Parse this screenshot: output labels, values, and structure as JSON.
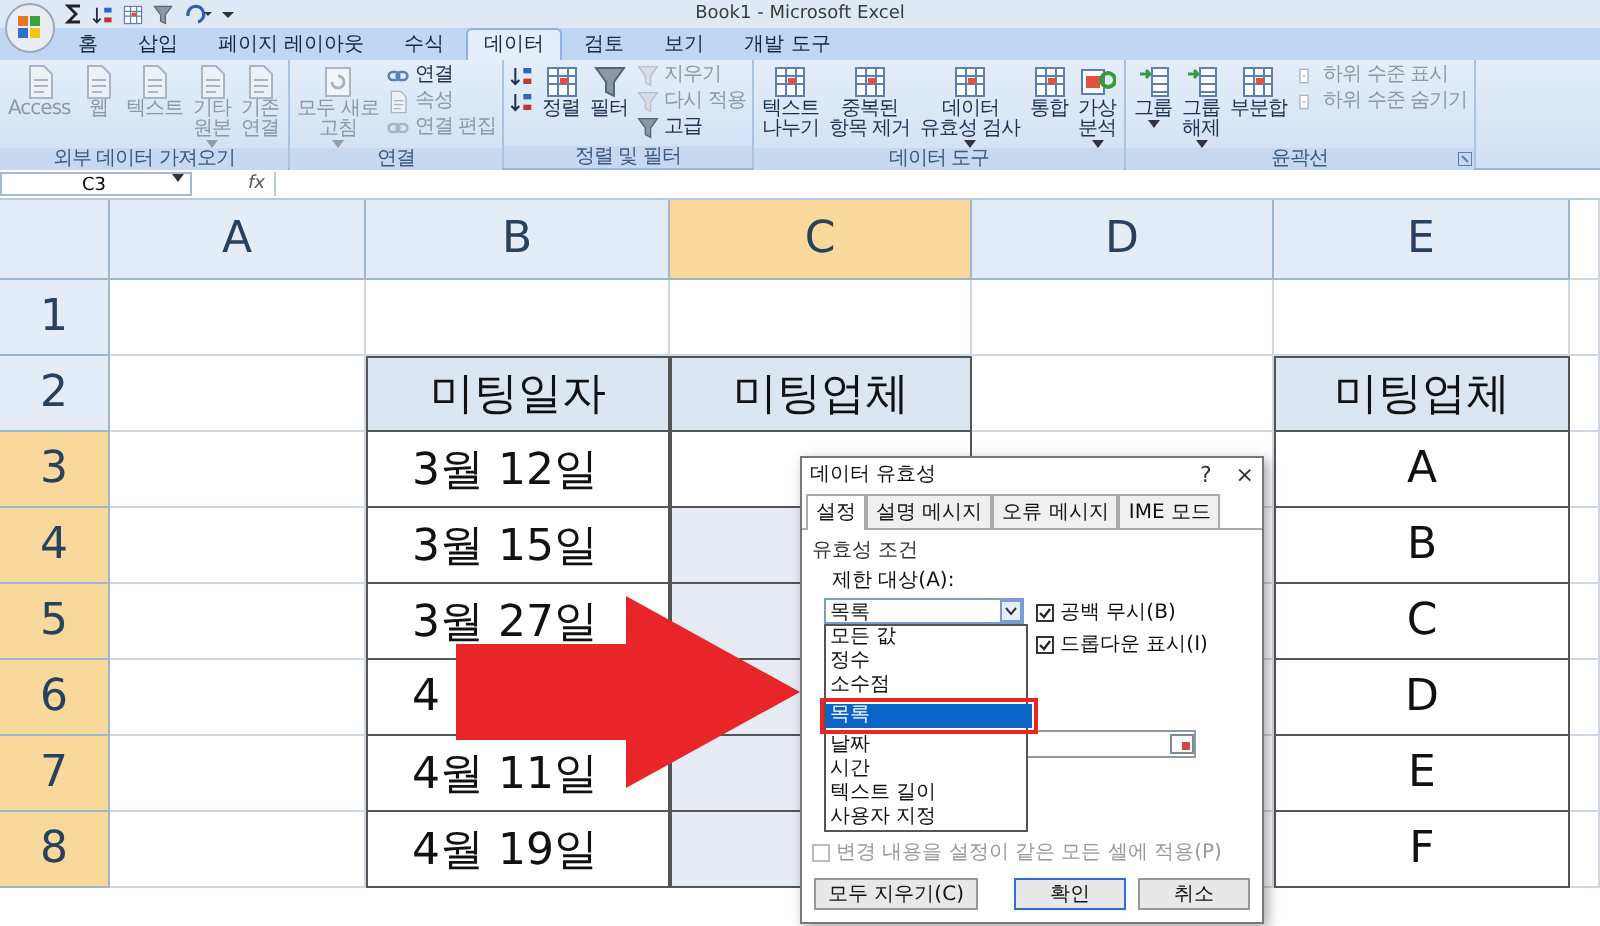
{
  "window": {
    "title": "Book1 - Microsoft Excel"
  },
  "tabs": [
    {
      "label": "홈",
      "selected": false
    },
    {
      "label": "삽입",
      "selected": false
    },
    {
      "label": "페이지 레이아웃",
      "selected": false
    },
    {
      "label": "수식",
      "selected": false
    },
    {
      "label": "데이터",
      "selected": true
    },
    {
      "label": "검토",
      "selected": false
    },
    {
      "label": "보기",
      "selected": false
    },
    {
      "label": "개발 도구",
      "selected": false
    }
  ],
  "ribbon": {
    "groups": [
      {
        "label": "외부 데이터 가져오기",
        "items": [
          {
            "kind": "large",
            "label": "Access",
            "disabled": true
          },
          {
            "kind": "large",
            "label": "웹",
            "disabled": true
          },
          {
            "kind": "large",
            "label": "텍스트",
            "disabled": true
          },
          {
            "kind": "large",
            "label": "기타\n원본",
            "menu": true,
            "disabled": true
          },
          {
            "kind": "large",
            "label": "기존\n연결",
            "disabled": true
          }
        ]
      },
      {
        "label": "연결",
        "items": [
          {
            "kind": "large",
            "label": "모두 새로\n고침",
            "menu": true,
            "disabled": true
          },
          {
            "kind": "stack",
            "items": [
              {
                "label": "연결",
                "disabled": false
              },
              {
                "label": "속성",
                "disabled": true
              },
              {
                "label": "연결 편집",
                "disabled": true
              }
            ]
          }
        ]
      },
      {
        "label": "정렬 및 필터",
        "items": [
          {
            "kind": "stack",
            "items": [
              {
                "disabled": false
              },
              {
                "disabled": false
              }
            ]
          },
          {
            "kind": "large",
            "label": "정렬",
            "disabled": false
          },
          {
            "kind": "large",
            "label": "필터",
            "disabled": false
          },
          {
            "kind": "stack",
            "items": [
              {
                "label": "지우기",
                "disabled": true
              },
              {
                "label": "다시 적용",
                "disabled": true
              },
              {
                "label": "고급",
                "disabled": false
              }
            ]
          }
        ]
      },
      {
        "label": "데이터 도구",
        "items": [
          {
            "kind": "large",
            "label": "텍스트\n나누기",
            "disabled": false
          },
          {
            "kind": "large",
            "label": "중복된\n항목 제거",
            "disabled": false
          },
          {
            "kind": "large",
            "label": "데이터\n유효성 검사",
            "menu": true,
            "disabled": false
          },
          {
            "kind": "large",
            "label": "통합",
            "disabled": false
          },
          {
            "kind": "large",
            "label": "가상\n분석",
            "menu": true,
            "disabled": false
          }
        ]
      },
      {
        "label": "윤곽선",
        "launcher": true,
        "items": [
          {
            "kind": "large",
            "label": "그룹",
            "menu": true,
            "disabled": false
          },
          {
            "kind": "large",
            "label": "그룹\n해제",
            "menu": true,
            "disabled": false
          },
          {
            "kind": "large",
            "label": "부분합",
            "disabled": false
          },
          {
            "kind": "stack",
            "items": [
              {
                "label": "하위 수준 표시",
                "disabled": true
              },
              {
                "label": "하위 수준 숨기기",
                "disabled": true
              }
            ]
          }
        ]
      }
    ]
  },
  "formula_bar": {
    "name_box": "C3",
    "function_label": "fx"
  },
  "sheet": {
    "columns": [
      {
        "label": "A",
        "selected": false
      },
      {
        "label": "B",
        "selected": false
      },
      {
        "label": "C",
        "selected": true
      },
      {
        "label": "D",
        "selected": false
      },
      {
        "label": "E",
        "selected": false
      }
    ],
    "rows": [
      {
        "label": "1",
        "selected": false,
        "cells": [
          "",
          "",
          "",
          "",
          ""
        ]
      },
      {
        "label": "2",
        "selected": false,
        "cells": [
          "",
          {
            "kind": "header",
            "text": "미팅일자"
          },
          {
            "kind": "header",
            "text": "미팅업체"
          },
          "",
          {
            "kind": "header",
            "text": "미팅업체"
          }
        ]
      },
      {
        "label": "3",
        "selected": true,
        "cells": [
          "",
          {
            "kind": "date",
            "text": "3월 12일"
          },
          {
            "kind": "input",
            "selected": false
          },
          "",
          {
            "kind": "data",
            "text": "A"
          }
        ]
      },
      {
        "label": "4",
        "selected": true,
        "cells": [
          "",
          {
            "kind": "date",
            "text": "3월 15일"
          },
          {
            "kind": "input",
            "selected": true
          },
          "",
          {
            "kind": "data",
            "text": "B"
          }
        ]
      },
      {
        "label": "5",
        "selected": true,
        "cells": [
          "",
          {
            "kind": "date",
            "text": "3월 27일"
          },
          {
            "kind": "input",
            "selected": true
          },
          "",
          {
            "kind": "data",
            "text": "C"
          }
        ]
      },
      {
        "label": "6",
        "selected": true,
        "cells": [
          "",
          {
            "kind": "date",
            "text": "4"
          },
          {
            "kind": "input",
            "selected": true
          },
          "",
          {
            "kind": "data",
            "text": "D"
          }
        ]
      },
      {
        "label": "7",
        "selected": true,
        "cells": [
          "",
          {
            "kind": "date",
            "text": "4월 11일"
          },
          {
            "kind": "input",
            "selected": true
          },
          "",
          {
            "kind": "data",
            "text": "E"
          }
        ]
      },
      {
        "label": "8",
        "selected": true,
        "cells": [
          "",
          {
            "kind": "date",
            "text": "4월 19일"
          },
          {
            "kind": "input",
            "selected": true
          },
          "",
          {
            "kind": "data",
            "text": "F"
          }
        ]
      }
    ]
  },
  "dialog": {
    "title": "데이터 유효성",
    "help": "?",
    "close": "×",
    "tabs": [
      {
        "label": "설정",
        "selected": true
      },
      {
        "label": "설명 메시지",
        "selected": false
      },
      {
        "label": "오류 메시지",
        "selected": false
      },
      {
        "label": "IME 모드",
        "selected": false
      }
    ],
    "group_label": "유효성 조건",
    "allow_label": "제한 대상(A):",
    "allow_value": "목록",
    "options": [
      {
        "label": "모든 값",
        "selected": false,
        "highlighted": false
      },
      {
        "label": "정수",
        "selected": false,
        "highlighted": false
      },
      {
        "label": "소수점",
        "selected": false,
        "highlighted": false
      },
      {
        "label": "목록",
        "selected": true,
        "highlighted": true
      },
      {
        "label": "날짜",
        "selected": false,
        "highlighted": false
      },
      {
        "label": "시간",
        "selected": false,
        "highlighted": false
      },
      {
        "label": "텍스트 길이",
        "selected": false,
        "highlighted": false
      },
      {
        "label": "사용자 지정",
        "selected": false,
        "highlighted": false
      }
    ],
    "checkboxes": [
      {
        "label": "공백 무시(B)",
        "checked": true
      },
      {
        "label": "드롭다운 표시(I)",
        "checked": true
      }
    ],
    "apply_all": {
      "label": "변경 내용을 설정이 같은 모든 셀에 적용(P)",
      "checked": false,
      "disabled": true
    },
    "buttons": [
      {
        "label": "모두 지우기(C)",
        "default": false
      },
      {
        "label": "확인",
        "default": true
      },
      {
        "label": "취소",
        "default": false
      }
    ]
  },
  "arrow": {
    "kind": "arrow"
  }
}
